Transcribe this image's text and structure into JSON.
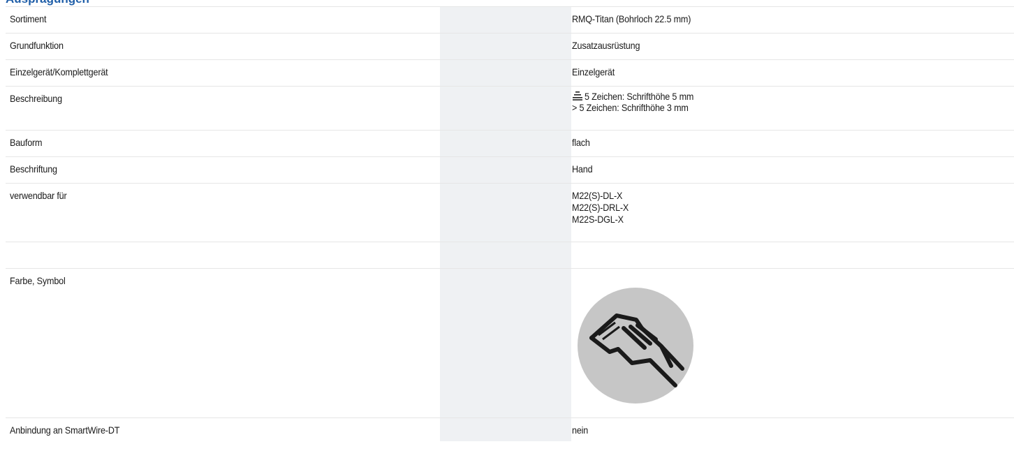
{
  "section": {
    "title": "Ausprägungen"
  },
  "rows": [
    {
      "label": "Sortiment",
      "value": [
        "RMQ-Titan (Bohrloch 22.5 mm)"
      ]
    },
    {
      "label": "Grundfunktion",
      "value": [
        "Zusatzausrüstung"
      ]
    },
    {
      "label": "Einzelgerät/Komplettgerät",
      "value": [
        "Einzelgerät"
      ]
    },
    {
      "label": "Beschreibung",
      "value": [
        "5 Zeichen: Schrifthöhe 5 mm",
        "> 5 Zeichen: Schrifthöhe 3 mm"
      ],
      "icon": "text-height-icon"
    },
    {
      "label": "Bauform",
      "value": [
        "flach"
      ]
    },
    {
      "label": "Beschriftung",
      "value": [
        "Hand"
      ]
    },
    {
      "label": "verwendbar für",
      "value": [
        "M22(S)-DL-X",
        "M22(S)-DRL-X",
        "M22S-DGL-X"
      ]
    },
    {
      "label": "",
      "value": []
    },
    {
      "label": "Farbe, Symbol",
      "value": [],
      "image": "hand-writing-symbol-icon"
    },
    {
      "label": "Anbindung an SmartWire-DT",
      "value": [
        "nein"
      ]
    }
  ],
  "colors": {
    "title": "#1f5ea8",
    "mid_column": "#eff1f3",
    "divider": "#e6e6e6",
    "symbol_circle": "#c6c6c6"
  }
}
